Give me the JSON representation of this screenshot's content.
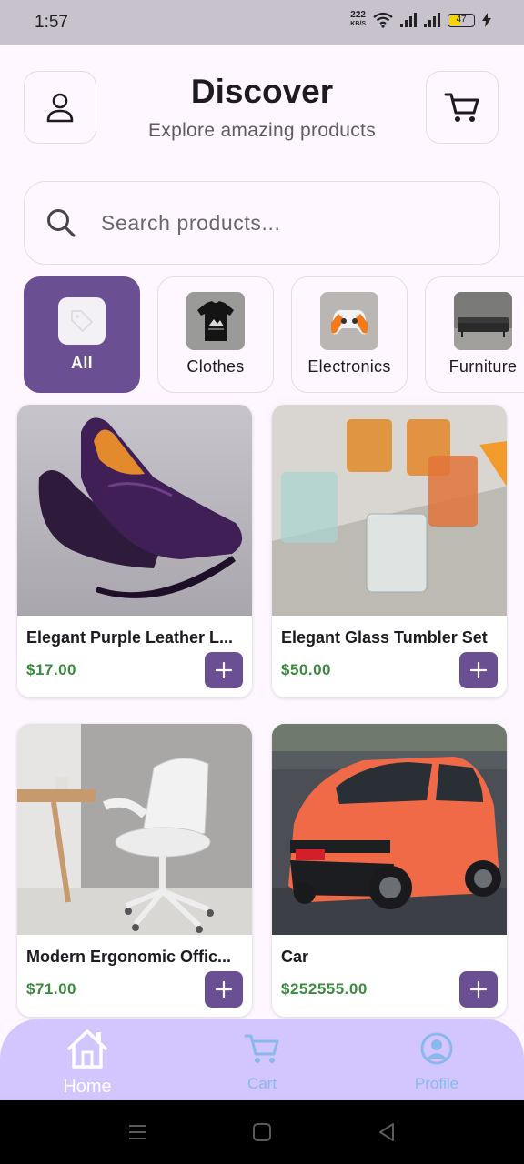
{
  "status_bar": {
    "time": "1:57",
    "net_speed_value": "222",
    "net_speed_unit": "KB/S",
    "battery": "47"
  },
  "header": {
    "title": "Discover",
    "subtitle": "Explore amazing products",
    "profile_icon": "person-icon",
    "cart_icon": "cart-icon"
  },
  "search": {
    "placeholder": "Search products...",
    "value": ""
  },
  "categories": [
    {
      "label": "All",
      "icon": "tag-icon",
      "selected": true
    },
    {
      "label": "Clothes",
      "icon": "tshirt-thumbnail",
      "selected": false
    },
    {
      "label": "Electronics",
      "icon": "gamepad-thumbnail",
      "selected": false
    },
    {
      "label": "Furniture",
      "icon": "sofa-thumbnail",
      "selected": false
    }
  ],
  "products": [
    {
      "name": "Elegant Purple Leather L...",
      "price": "$17.00",
      "image": "purple-loafers"
    },
    {
      "name": "Elegant Glass Tumbler Set",
      "price": "$50.00",
      "image": "glass-tumblers"
    },
    {
      "name": "Modern Ergonomic Offic...",
      "price": "$71.00",
      "image": "office-chair"
    },
    {
      "name": "Car",
      "price": "$252555.00",
      "image": "orange-suv"
    }
  ],
  "bottom_nav": [
    {
      "label": "Home",
      "icon": "home-icon",
      "active": true
    },
    {
      "label": "Cart",
      "icon": "cart-icon",
      "active": false
    },
    {
      "label": "Profile",
      "icon": "account-circle-icon",
      "active": false
    }
  ],
  "colors": {
    "background": "#fef7ff",
    "accent": "#6b4f93",
    "price": "#3b8a3e",
    "nav_background": "#d3c6ff"
  }
}
